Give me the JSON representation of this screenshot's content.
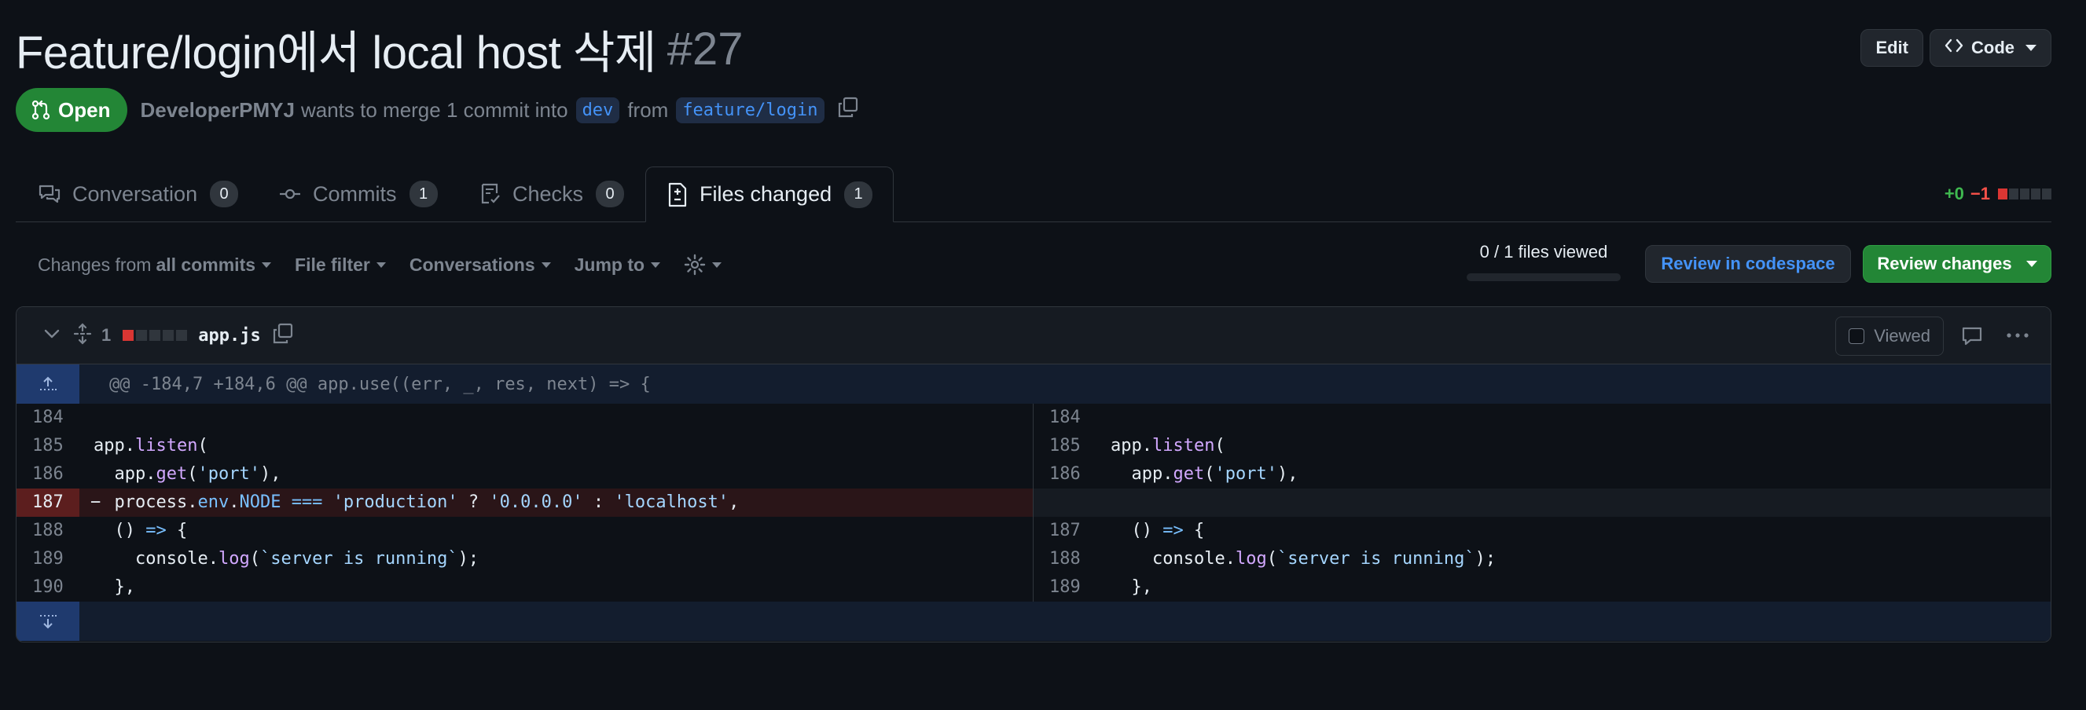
{
  "pr": {
    "title": "Feature/login에서 local host 삭제",
    "number": "#27",
    "state": "Open",
    "author": "DeveloperPMYJ",
    "merge_text": "wants to merge 1 commit into",
    "base_branch": "dev",
    "from_text": "from",
    "head_branch": "feature/login"
  },
  "header_buttons": {
    "edit": "Edit",
    "code": "Code"
  },
  "tabs": [
    {
      "label": "Conversation",
      "count": "0"
    },
    {
      "label": "Commits",
      "count": "1"
    },
    {
      "label": "Checks",
      "count": "0"
    },
    {
      "label": "Files changed",
      "count": "1"
    }
  ],
  "diffstat": {
    "additions": "+0",
    "deletions": "−1"
  },
  "toolbar": {
    "changes_from": "Changes from",
    "all_commits": "all commits",
    "file_filter": "File filter",
    "conversations": "Conversations",
    "jump_to": "Jump to",
    "files_viewed": "0 / 1 files viewed",
    "review_codespace": "Review in codespace",
    "review_changes": "Review changes"
  },
  "file": {
    "change_count": "1",
    "name": "app.js",
    "viewed_label": "Viewed",
    "hunk_header": "@@ -184,7 +184,6 @@ app.use((err, _, res, next) => {"
  },
  "diff_left_lines": [
    "184",
    "185",
    "186",
    "187",
    "188",
    "189",
    "190"
  ],
  "diff_right_lines": [
    "184",
    "185",
    "186",
    "",
    "187",
    "188",
    "189"
  ],
  "colors": {
    "background": "#0d1117",
    "accent_green": "#238636",
    "link_blue": "#4493f8",
    "deletion_red": "#f85149"
  }
}
